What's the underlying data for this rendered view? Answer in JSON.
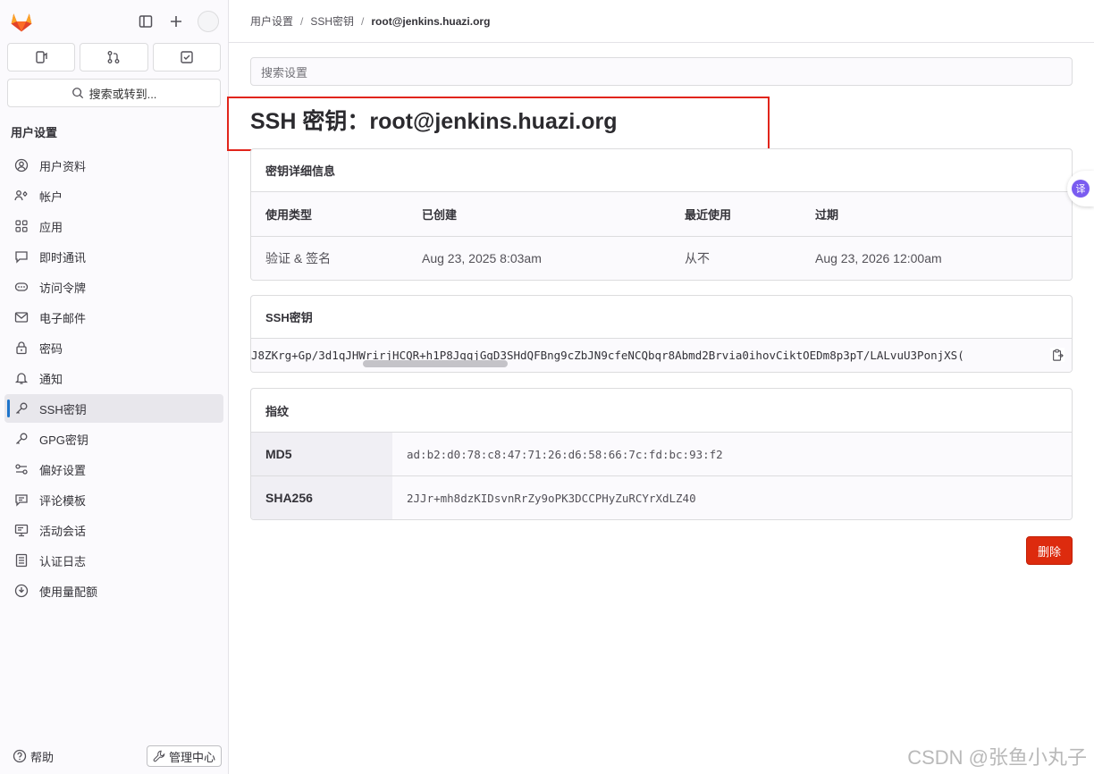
{
  "sidebar": {
    "search_label": "搜索或转到...",
    "section_title": "用户设置",
    "items": [
      {
        "label": "用户资料",
        "icon": "user-profile-icon"
      },
      {
        "label": "帐户",
        "icon": "account-icon"
      },
      {
        "label": "应用",
        "icon": "applications-icon"
      },
      {
        "label": "即时通讯",
        "icon": "chat-icon"
      },
      {
        "label": "访问令牌",
        "icon": "token-icon"
      },
      {
        "label": "电子邮件",
        "icon": "mail-icon"
      },
      {
        "label": "密码",
        "icon": "lock-icon"
      },
      {
        "label": "通知",
        "icon": "bell-icon"
      },
      {
        "label": "SSH密钥",
        "icon": "key-icon",
        "active": true
      },
      {
        "label": "GPG密钥",
        "icon": "key-icon"
      },
      {
        "label": "偏好设置",
        "icon": "preferences-icon"
      },
      {
        "label": "评论模板",
        "icon": "comment-template-icon"
      },
      {
        "label": "活动会话",
        "icon": "monitor-icon"
      },
      {
        "label": "认证日志",
        "icon": "log-icon"
      },
      {
        "label": "使用量配额",
        "icon": "quota-icon"
      }
    ],
    "help_label": "帮助",
    "admin_label": "管理中心"
  },
  "breadcrumb": {
    "items": [
      "用户设置",
      "SSH密钥",
      "root@jenkins.huazi.org"
    ]
  },
  "search": {
    "placeholder": "搜索设置"
  },
  "page": {
    "title": "SSH 密钥：root@jenkins.huazi.org",
    "details_title": "密钥详细信息",
    "columns": [
      "使用类型",
      "已创建",
      "最近使用",
      "过期"
    ],
    "values": [
      "验证 & 签名",
      "Aug 23, 2025 8:03am",
      "从不",
      "Aug 23, 2026 12:00am"
    ],
    "ssh_key_title": "SSH密钥",
    "ssh_key_value": "J8ZKrg+Gp/3d1qJHWrirjHCQR+h1P8JqqjGgD3SHdQFBng9cZbJN9cfeNCQbqr8Abmd2Brvia0ihovCiktOEDm8p3pT/LALvuU3PonjXS(",
    "fingerprint_title": "指纹",
    "fingerprints": [
      {
        "label": "MD5",
        "value": "ad:b2:d0:78:c8:47:71:26:d6:58:66:7c:fd:bc:93:f2"
      },
      {
        "label": "SHA256",
        "value": "2JJr+mh8dzKIDsvnRrZy9oPK3DCCPHyZuRCYrXdLZ40"
      }
    ],
    "delete_label": "删除"
  },
  "translate_fab": "译",
  "watermark": "CSDN @张鱼小丸子",
  "colors": {
    "accent": "#1f75cb",
    "danger": "#dd2b0e",
    "highlight_box": "#e1251b"
  }
}
